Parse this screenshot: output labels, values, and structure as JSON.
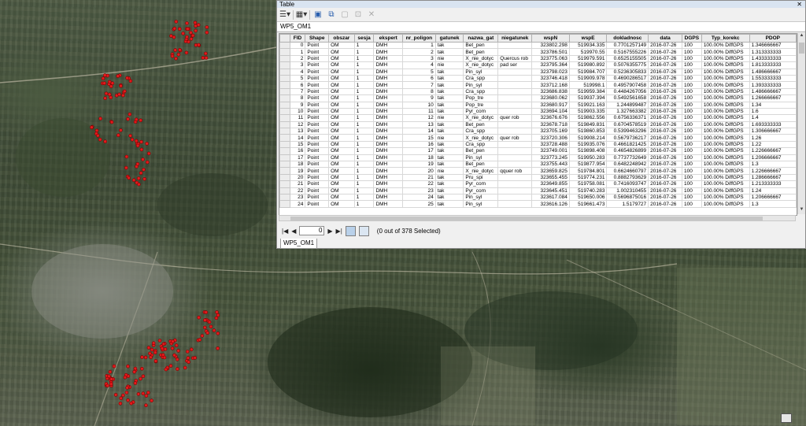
{
  "window_title": "Table",
  "table_tab": "WP5_OM1",
  "bottom_tab": "WP5_OM1",
  "columns": [
    "FID",
    "Shape",
    "obszar",
    "sesja",
    "ekspert",
    "nr_poligon",
    "gatunek",
    "nazwa_gat",
    "niegatunek",
    "wspN",
    "wspE",
    "dokladnosc",
    "data",
    "DGPS",
    "Typ_korekc",
    "PDOP"
  ],
  "rows": [
    [
      "0",
      "Point",
      "OM",
      "1",
      "DMH",
      "1",
      "tak",
      "Bet_pen",
      "",
      "323802.298",
      "519934.335",
      "0.7701257149",
      "2016-07-26",
      "100",
      "100.00% DiffGPS",
      "1.346666667"
    ],
    [
      "1",
      "Point",
      "OM",
      "1",
      "DMH",
      "2",
      "tak",
      "Bet_pen",
      "",
      "323786.501",
      "519970.55",
      "0.5167555226",
      "2016-07-26",
      "100",
      "100.00% DiffGPS",
      "1.313333333"
    ],
    [
      "2",
      "Point",
      "OM",
      "1",
      "DMH",
      "3",
      "nie",
      "X_nie_dotyc",
      "Quercus rob",
      "323775.063",
      "519979.591",
      "0.6525155505",
      "2016-07-26",
      "100",
      "100.00% DiffGPS",
      "1.433333333"
    ],
    [
      "3",
      "Point",
      "OM",
      "1",
      "DMH",
      "4",
      "nie",
      "X_nie_dotyc",
      "pad ser",
      "323795.364",
      "519980.892",
      "0.5076355775",
      "2016-07-26",
      "100",
      "100.00% DiffGPS",
      "1.813333333"
    ],
    [
      "4",
      "Point",
      "OM",
      "1",
      "DMH",
      "5",
      "tak",
      "Pin_syl",
      "",
      "323798.023",
      "519984.707",
      "0.5236305833",
      "2016-07-26",
      "100",
      "100.00% DiffGPS",
      "1.486666667"
    ],
    [
      "5",
      "Point",
      "OM",
      "1",
      "DMH",
      "6",
      "tak",
      "Cra_spp",
      "",
      "323746.418",
      "519909.978",
      "0.4690286517",
      "2016-07-26",
      "100",
      "100.00% DiffGPS",
      "1.553333333"
    ],
    [
      "6",
      "Point",
      "OM",
      "1",
      "DMH",
      "7",
      "tak",
      "Pin_syl",
      "",
      "323712.168",
      "519998.1",
      "0.4957907458",
      "2016-07-26",
      "100",
      "100.00% DiffGPS",
      "1.393333333"
    ],
    [
      "7",
      "Point",
      "OM",
      "1",
      "DMH",
      "8",
      "tak",
      "Cra_spp",
      "",
      "323686.838",
      "519959.384",
      "0.4484267056",
      "2016-07-26",
      "100",
      "100.00% DiffGPS",
      "1.486666667"
    ],
    [
      "8",
      "Point",
      "OM",
      "1",
      "DMH",
      "9",
      "tak",
      "Pop_tre",
      "",
      "323680.062",
      "519937.394",
      "0.5492561658",
      "2016-07-26",
      "100",
      "100.00% DiffGPS",
      "1.266666667"
    ],
    [
      "9",
      "Point",
      "OM",
      "1",
      "DMH",
      "10",
      "tak",
      "Pop_tre",
      "",
      "323680.917",
      "519921.163",
      "1.244899487",
      "2016-07-26",
      "100",
      "100.00% DiffGPS",
      "1.34"
    ],
    [
      "10",
      "Point",
      "OM",
      "1",
      "DMH",
      "11",
      "tak",
      "Pyr_com",
      "",
      "323694.104",
      "519903.335",
      "1.327663382",
      "2016-07-26",
      "100",
      "100.00% DiffGPS",
      "1.6"
    ],
    [
      "11",
      "Point",
      "OM",
      "1",
      "DMH",
      "12",
      "nie",
      "X_nie_dotyc",
      "quer rob",
      "323676.676",
      "519862.556",
      "0.6756336371",
      "2016-07-26",
      "100",
      "100.00% DiffGPS",
      "1.4"
    ],
    [
      "12",
      "Point",
      "OM",
      "1",
      "DMH",
      "13",
      "tak",
      "Bet_pen",
      "",
      "323678.718",
      "519849.831",
      "0.6704578519",
      "2016-07-26",
      "100",
      "100.00% DiffGPS",
      "1.693333333"
    ],
    [
      "13",
      "Point",
      "OM",
      "1",
      "DMH",
      "14",
      "tak",
      "Cra_spp",
      "",
      "323705.169",
      "519860.853",
      "0.5399463296",
      "2016-07-26",
      "100",
      "100.00% DiffGPS",
      "1.306666667"
    ],
    [
      "14",
      "Point",
      "OM",
      "1",
      "DMH",
      "15",
      "nie",
      "X_nie_dotyc",
      "quer rob",
      "323720.306",
      "519908.214",
      "0.5679736217",
      "2016-07-26",
      "100",
      "100.00% DiffGPS",
      "1.26"
    ],
    [
      "15",
      "Point",
      "OM",
      "1",
      "DMH",
      "16",
      "tak",
      "Cra_spp",
      "",
      "323728.488",
      "519935.076",
      "0.4661821425",
      "2016-07-26",
      "100",
      "100.00% DiffGPS",
      "1.22"
    ],
    [
      "16",
      "Point",
      "OM",
      "1",
      "DMH",
      "17",
      "tak",
      "Bet_pen",
      "",
      "323749.001",
      "519898.408",
      "0.4654826899",
      "2016-07-26",
      "100",
      "100.00% DiffGPS",
      "1.226666667"
    ],
    [
      "17",
      "Point",
      "OM",
      "1",
      "DMH",
      "18",
      "tak",
      "Pin_syl",
      "",
      "323773.245",
      "519950.283",
      "0.7737732649",
      "2016-07-26",
      "100",
      "100.00% DiffGPS",
      "1.206666667"
    ],
    [
      "18",
      "Point",
      "OM",
      "1",
      "DMH",
      "19",
      "tak",
      "Bet_pen",
      "",
      "323755.443",
      "519877.954",
      "0.6482248942",
      "2016-07-26",
      "100",
      "100.00% DiffGPS",
      "1.3"
    ],
    [
      "19",
      "Point",
      "OM",
      "1",
      "DMH",
      "20",
      "nie",
      "X_nie_dotyc",
      "qquer rob",
      "323659.825",
      "519784.801",
      "0.6624660797",
      "2016-07-26",
      "100",
      "100.00% DiffGPS",
      "1.226666667"
    ],
    [
      "20",
      "Point",
      "OM",
      "1",
      "DMH",
      "21",
      "tak",
      "Pru_spi",
      "",
      "323655.455",
      "519774.231",
      "0.8882793629",
      "2016-07-26",
      "100",
      "100.00% DiffGPS",
      "1.286666667"
    ],
    [
      "21",
      "Point",
      "OM",
      "1",
      "DMH",
      "22",
      "tak",
      "Pyr_com",
      "",
      "323649.855",
      "519758.081",
      "0.7416093747",
      "2016-07-26",
      "100",
      "100.00% DiffGPS",
      "1.213333333"
    ],
    [
      "22",
      "Point",
      "OM",
      "1",
      "DMH",
      "23",
      "tak",
      "Pyr_com",
      "",
      "323645.451",
      "519740.283",
      "1.002310455",
      "2016-07-26",
      "100",
      "100.00% DiffGPS",
      "1.24"
    ],
    [
      "23",
      "Point",
      "OM",
      "1",
      "DMH",
      "24",
      "tak",
      "Pin_syl",
      "",
      "323617.084",
      "519650.006",
      "0.5696875016",
      "2016-07-26",
      "100",
      "100.00% DiffGPS",
      "1.206666667"
    ],
    [
      "24",
      "Point",
      "OM",
      "1",
      "DMH",
      "25",
      "tak",
      "Pin_syl",
      "",
      "323616.126",
      "519661.473",
      "1.5179727",
      "2016-07-26",
      "100",
      "100.00% DiffGPS",
      "1.3"
    ]
  ],
  "record_value": "0",
  "selection_status": "(0 out of 378 Selected)",
  "icons": {
    "table_options": "table-options-icon",
    "related_tables": "related-tables-icon",
    "select_by_attributes": "select-by-attributes-icon",
    "switch_selection": "switch-selection-icon",
    "clear_selection": "clear-selection-icon",
    "zoom_to_selected": "zoom-to-selected-icon",
    "delete_selected": "delete-selected-icon"
  },
  "colors": {
    "point": "#e31a1c",
    "header_bg": "#ececec",
    "title_bg": "#d9e4f1"
  }
}
